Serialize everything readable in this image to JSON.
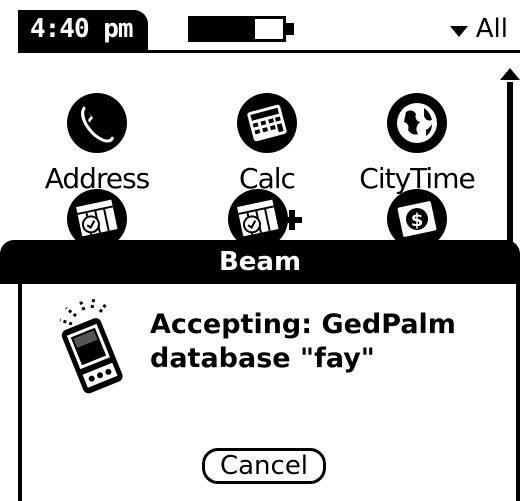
{
  "status_bar": {
    "time": "4:40 pm",
    "battery_level": 0.7,
    "category": "All"
  },
  "apps": [
    {
      "label": "Address",
      "icon": "phone-icon"
    },
    {
      "label": "Calc",
      "icon": "calculator-icon"
    },
    {
      "label": "CityTime",
      "icon": "globe-icon"
    },
    {
      "label": "",
      "icon": "date-book-icon"
    },
    {
      "label": "",
      "icon": "date-book-plus-icon"
    },
    {
      "label": "",
      "icon": "expense-icon"
    }
  ],
  "dialog": {
    "title": "Beam",
    "message_line1": "Accepting: GedPalm",
    "message_line2": "database \"fay\"",
    "cancel_label": "Cancel",
    "icon": "beaming-palm-icon"
  }
}
